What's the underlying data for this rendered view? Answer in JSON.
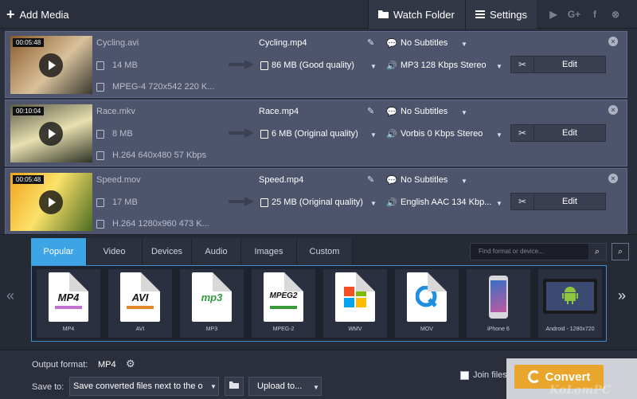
{
  "toolbar": {
    "add_media": "Add Media",
    "watch_folder": "Watch Folder",
    "settings": "Settings",
    "social": [
      "▶",
      "G+",
      "f",
      "⊗"
    ]
  },
  "files": [
    {
      "duration": "00:05:48",
      "source_name": "Cycling.avi",
      "source_size": "14 MB",
      "source_codec": "MPEG-4 720x542 220 K...",
      "output_name": "Cycling.mp4",
      "output_size": "86 MB (Good quality)",
      "subtitles": "No Subtitles",
      "audio": "MP3 128 Kbps Stereo",
      "edit": "Edit",
      "thumb_colors": [
        "#8a5a2a",
        "#d9c19a",
        "#3a3a30"
      ]
    },
    {
      "duration": "00:10:04",
      "source_name": "Race.mkv",
      "source_size": "8 MB",
      "source_codec": "H.264 640x480 57 Kbps",
      "output_name": "Race.mp4",
      "output_size": "6 MB (Original quality)",
      "subtitles": "No Subtitles",
      "audio": "Vorbis 0 Kbps Stereo",
      "edit": "Edit",
      "thumb_colors": [
        "#5a5a48",
        "#e8e0b0",
        "#2e3326"
      ]
    },
    {
      "duration": "00:05:48",
      "source_name": "Speed.mov",
      "source_size": "17 MB",
      "source_codec": "H.264 1280x960 473 K...",
      "output_name": "Speed.mp4",
      "output_size": "25 MB (Original quality)",
      "subtitles": "No Subtitles",
      "audio": "English AAC 134 Kbp...",
      "edit": "Edit",
      "thumb_colors": [
        "#f1a21b",
        "#fbe26a",
        "#4d6b21"
      ]
    }
  ],
  "format_tabs": [
    "Popular",
    "Video",
    "Devices",
    "Audio",
    "Images",
    "Custom"
  ],
  "active_tab": "Popular",
  "search_placeholder": "Find format or device...",
  "presets": [
    {
      "label": "MP4",
      "icon_text": "MP4",
      "icon": "mp4-file-icon"
    },
    {
      "label": "AVI",
      "icon_text": "AVI",
      "icon": "avi-file-icon"
    },
    {
      "label": "MP3",
      "icon_text": "mp3",
      "icon": "mp3-file-icon"
    },
    {
      "label": "MPEG-2",
      "icon_text": "MPEG2",
      "icon": "mpeg2-file-icon"
    },
    {
      "label": "WMV",
      "icon_text": "",
      "icon": "windows-logo-icon"
    },
    {
      "label": "MOV",
      "icon_text": "",
      "icon": "quicktime-icon"
    },
    {
      "label": "iPhone 6",
      "icon_text": "",
      "icon": "iphone-icon"
    },
    {
      "label": "Android - 1280x720",
      "icon_text": "",
      "icon": "android-tablet-icon"
    }
  ],
  "bottom": {
    "output_format_label": "Output format:",
    "output_format_value": "MP4",
    "save_to_label": "Save to:",
    "save_to_value": "Save converted files next to the o",
    "upload_to": "Upload to...",
    "join_files": "Join files",
    "convert": "Convert"
  },
  "watermark": "KoLomPC",
  "colors": {
    "accent_blue": "#3da5e6",
    "row_bg": "#4e546c",
    "convert_orange": "#e9a52c"
  }
}
